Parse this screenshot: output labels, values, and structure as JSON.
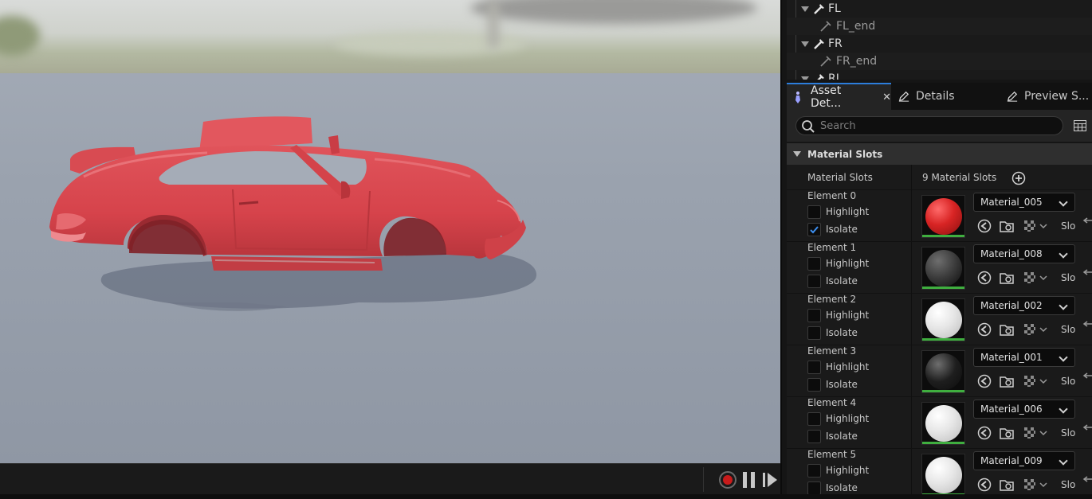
{
  "skeleton_tree": {
    "rows": [
      {
        "name": "FL",
        "type": "bone"
      },
      {
        "name": "FL_end",
        "type": "end"
      },
      {
        "name": "FR",
        "type": "bone"
      },
      {
        "name": "FR_end",
        "type": "end"
      },
      {
        "name": "RL",
        "type": "bone"
      }
    ]
  },
  "tabs": [
    {
      "label": "Asset Det...",
      "active": true,
      "closable": true
    },
    {
      "label": "Details",
      "active": false
    },
    {
      "label": "Preview S...",
      "active": false
    }
  ],
  "close_glyph": "✕",
  "search": {
    "placeholder": "Search",
    "value": ""
  },
  "section": {
    "title": "Material Slots"
  },
  "material_slots_row": {
    "label": "Material Slots",
    "count_text": "9 Material Slots"
  },
  "highlight_label": "Highlight",
  "isolate_label": "Isolate",
  "slot_suffix": "Slo",
  "elements": [
    {
      "label": "Element 0",
      "material": "Material_005",
      "highlight": false,
      "isolate": true,
      "color": "#d02525"
    },
    {
      "label": "Element 1",
      "material": "Material_008",
      "highlight": false,
      "isolate": false,
      "color": "#3a3a3a"
    },
    {
      "label": "Element 2",
      "material": "Material_002",
      "highlight": false,
      "isolate": false,
      "color": "#e8e8e8"
    },
    {
      "label": "Element 3",
      "material": "Material_001",
      "highlight": false,
      "isolate": false,
      "color": "#1e1e1e"
    },
    {
      "label": "Element 4",
      "material": "Material_006",
      "highlight": false,
      "isolate": false,
      "color": "#e8e8e8"
    },
    {
      "label": "Element 5",
      "material": "Material_009",
      "highlight": false,
      "isolate": false,
      "color": "#e8e8e8"
    }
  ],
  "colors": {
    "accent": "#2c7ddb",
    "car_body": "#d8474f",
    "record": "#c81b1b",
    "thumb_underline": "#3fae3f"
  }
}
